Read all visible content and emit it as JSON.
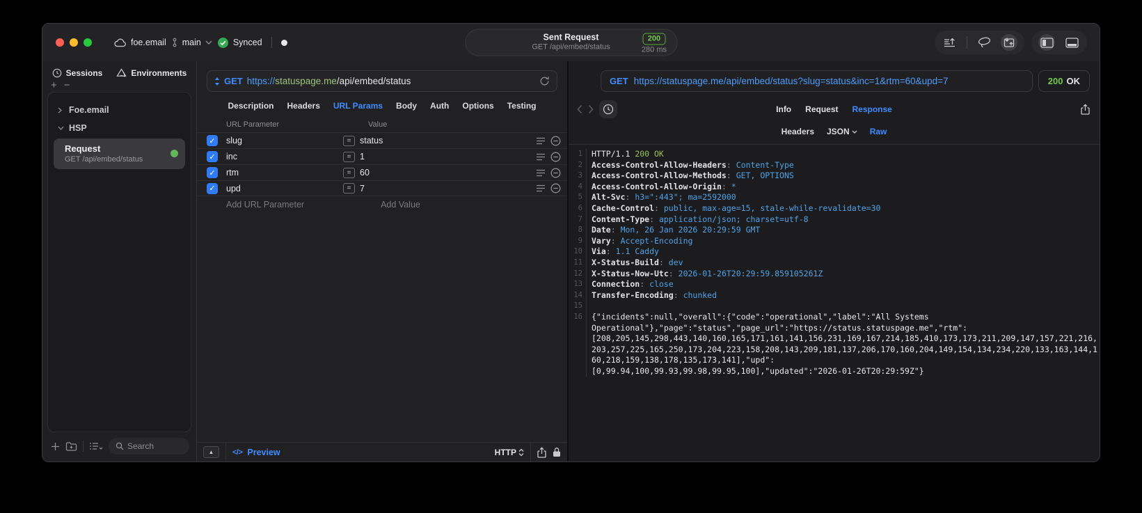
{
  "titlebar": {
    "project": "foe.email",
    "branch": "main",
    "sync_status": "Synced",
    "request_title": "Sent Request",
    "request_subtitle": "GET /api/embed/status",
    "status_code": "200",
    "duration": "280 ms"
  },
  "sidebar": {
    "tabs": [
      {
        "label": "Sessions",
        "icon": "clock-icon"
      },
      {
        "label": "Environments",
        "icon": "layers-icon"
      }
    ],
    "tree": [
      {
        "label": "Foe.email",
        "state": "collapsed"
      },
      {
        "label": "HSP",
        "state": "expanded"
      }
    ],
    "request_item": {
      "title": "Request",
      "subtitle": "GET /api/embed/status"
    },
    "search_placeholder": "Search"
  },
  "request_pane": {
    "method": "GET",
    "url_scheme": "https://",
    "url_host": "statuspage.me",
    "url_path": "/api/embed/status",
    "tabs": [
      "Description",
      "Headers",
      "URL Params",
      "Body",
      "Auth",
      "Options",
      "Testing"
    ],
    "active_tab": "URL Params",
    "params_table": {
      "columns": [
        "URL Parameter",
        "Value"
      ],
      "rows": [
        {
          "enabled": true,
          "name": "slug",
          "value": "status"
        },
        {
          "enabled": true,
          "name": "inc",
          "value": "1"
        },
        {
          "enabled": true,
          "name": "rtm",
          "value": "60"
        },
        {
          "enabled": true,
          "name": "upd",
          "value": "7"
        }
      ],
      "add_name_placeholder": "Add URL Parameter",
      "add_value_placeholder": "Add Value"
    },
    "footer": {
      "preview_label": "Preview",
      "code_glyph": "</>",
      "protocol": "HTTP"
    }
  },
  "response_pane": {
    "method": "GET",
    "url": "https://statuspage.me/api/embed/status?slug=status&inc=1&rtm=60&upd=7",
    "status_code": "200",
    "status_text": "OK",
    "tabs": [
      "Info",
      "Request",
      "Response"
    ],
    "active_tab": "Response",
    "subtabs": [
      "Headers",
      "JSON",
      "Raw"
    ],
    "active_subtab": "Raw",
    "status_line": {
      "protocol": "HTTP/1.1 ",
      "status": "200 OK"
    },
    "headers": [
      {
        "name": "Access-Control-Allow-Headers",
        "value": "Content-Type"
      },
      {
        "name": "Access-Control-Allow-Methods",
        "value": "GET, OPTIONS"
      },
      {
        "name": "Access-Control-Allow-Origin",
        "value": "*"
      },
      {
        "name": "Alt-Svc",
        "value": "h3=\":443\"; ma=2592000"
      },
      {
        "name": "Cache-Control",
        "value": "public, max-age=15, stale-while-revalidate=30"
      },
      {
        "name": "Content-Type",
        "value": "application/json; charset=utf-8"
      },
      {
        "name": "Date",
        "value": "Mon, 26 Jan 2026 20:29:59 GMT"
      },
      {
        "name": "Vary",
        "value": "Accept-Encoding"
      },
      {
        "name": "Via",
        "value": "1.1 Caddy"
      },
      {
        "name": "X-Status-Build",
        "value": "dev"
      },
      {
        "name": "X-Status-Now-Utc",
        "value": "2026-01-26T20:29:59.859105261Z"
      },
      {
        "name": "Connection",
        "value": "close"
      },
      {
        "name": "Transfer-Encoding",
        "value": "chunked"
      }
    ],
    "body_lines": [
      "{\"incidents\":null,\"overall\":{\"code\":\"operational\",\"label\":\"All Systems",
      "Operational\"},\"page\":\"status\",\"page_url\":\"https://status.statuspage.me\",\"rtm\":",
      "[208,205,145,298,443,140,160,165,171,161,141,156,231,169,167,214,185,410,173,173,211,209,147,157,221,216,",
      "203,257,225,165,250,173,204,223,158,208,143,209,181,137,206,170,160,204,149,154,134,234,220,133,163,144,1",
      "60,218,159,138,178,135,173,141],\"upd\":",
      "[0,99.94,100,99.93,99.98,99.95,100],\"updated\":\"2026-01-26T20:29:59Z\"}"
    ]
  }
}
